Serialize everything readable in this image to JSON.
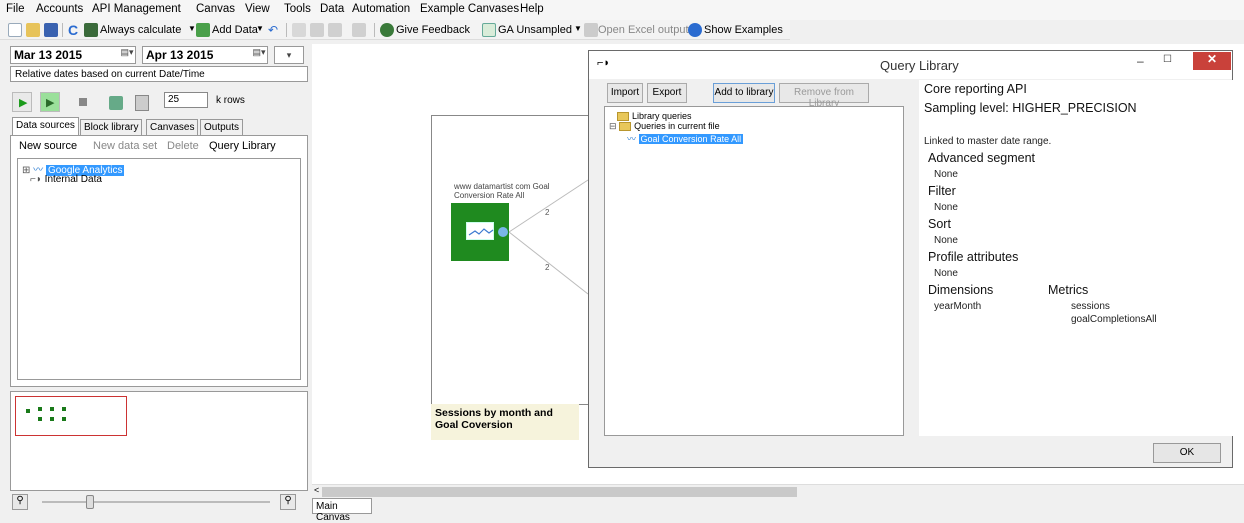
{
  "menubar": {
    "items": [
      "File",
      "Accounts",
      "API Management",
      "Canvas",
      "View",
      "Tools",
      "Data",
      "Automation",
      "Example Canvases",
      "Help"
    ]
  },
  "toolbar": {
    "always_calculate": "Always calculate",
    "add_data": "Add Data",
    "give_feedback": "Give Feedback",
    "ga_unsampled": "GA Unsampled",
    "open_excel": "Open Excel outputs",
    "show_examples": "Show Examples"
  },
  "dates": {
    "start": "Mar 13 2015",
    "end": "Apr 13 2015",
    "relative_note": "Relative dates based on current Date/Time"
  },
  "run_controls": {
    "rows_value": "25",
    "rows_unit": "k rows"
  },
  "left_tabs": [
    "Data sources",
    "Block library",
    "Canvases",
    "Outputs"
  ],
  "datasource_actions": [
    "New source",
    "New data set",
    "Delete",
    "Query Library"
  ],
  "datasource_tree": [
    "Google Analytics",
    "Internal Data"
  ],
  "canvas": {
    "node_caption": "www datamartist com Goal Conversion Rate  All",
    "edge_label_1": "2",
    "edge_label_2": "2",
    "note": "Sessions by month and Goal Coversion",
    "main_tab": "Main Canvas"
  },
  "dialog": {
    "title": "Query Library",
    "buttons": {
      "import": "Import",
      "export": "Export",
      "add_to_library": "Add to library",
      "remove_from_library": "Remove from Library",
      "ok": "OK"
    },
    "tree": {
      "library_queries": "Library queries",
      "queries_in_file": "Queries in current file",
      "selected_query": "Goal Conversion Rate  All"
    },
    "info": {
      "api": "Core reporting API",
      "sampling": "Sampling level: HIGHER_PRECISION",
      "linked": "Linked to master date range.",
      "advanced_segment_label": "Advanced segment",
      "advanced_segment_value": "None",
      "filter_label": "Filter",
      "filter_value": "None",
      "sort_label": "Sort",
      "sort_value": "None",
      "profile_attributes_label": "Profile attributes",
      "profile_attributes_value": "None",
      "dimensions_label": "Dimensions",
      "dimensions": [
        "yearMonth"
      ],
      "metrics_label": "Metrics",
      "metrics": [
        "sessions",
        "goalCompletionsAll"
      ]
    }
  },
  "colors": {
    "node_green": "#1f8a1f",
    "close_red": "#c9413a",
    "selection_blue": "#3399ff",
    "note_yellow": "#f6f3dc"
  }
}
